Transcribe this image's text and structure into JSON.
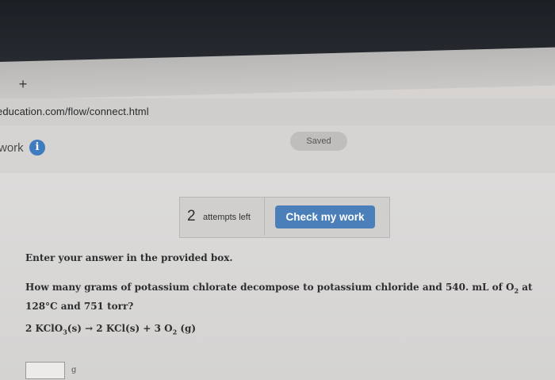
{
  "browser": {
    "new_tab_symbol": "+",
    "url": "education.com/flow/connect.html"
  },
  "header": {
    "work_label": "work",
    "info_icon_glyph": "i",
    "saved_label": "Saved"
  },
  "attempts": {
    "count": "2",
    "label": "attempts left",
    "check_button": "Check my work"
  },
  "question": {
    "instruction": "Enter your answer in the provided box.",
    "prompt_part1": "How many grams of potassium chlorate decompose to potassium chloride and 540. mL of O",
    "prompt_sub": "2",
    "prompt_part2": " at 128°C and 751 torr?",
    "eq_part1": "2 KClO",
    "eq_sub1": "3",
    "eq_part2": "(s) → 2 KCl(s) + 3 O",
    "eq_sub2": "2",
    "eq_part3": " (g)"
  },
  "answer": {
    "value": "",
    "unit": "g"
  },
  "colors": {
    "accent": "#4a7fba",
    "info_icon": "#3f7bbf"
  }
}
